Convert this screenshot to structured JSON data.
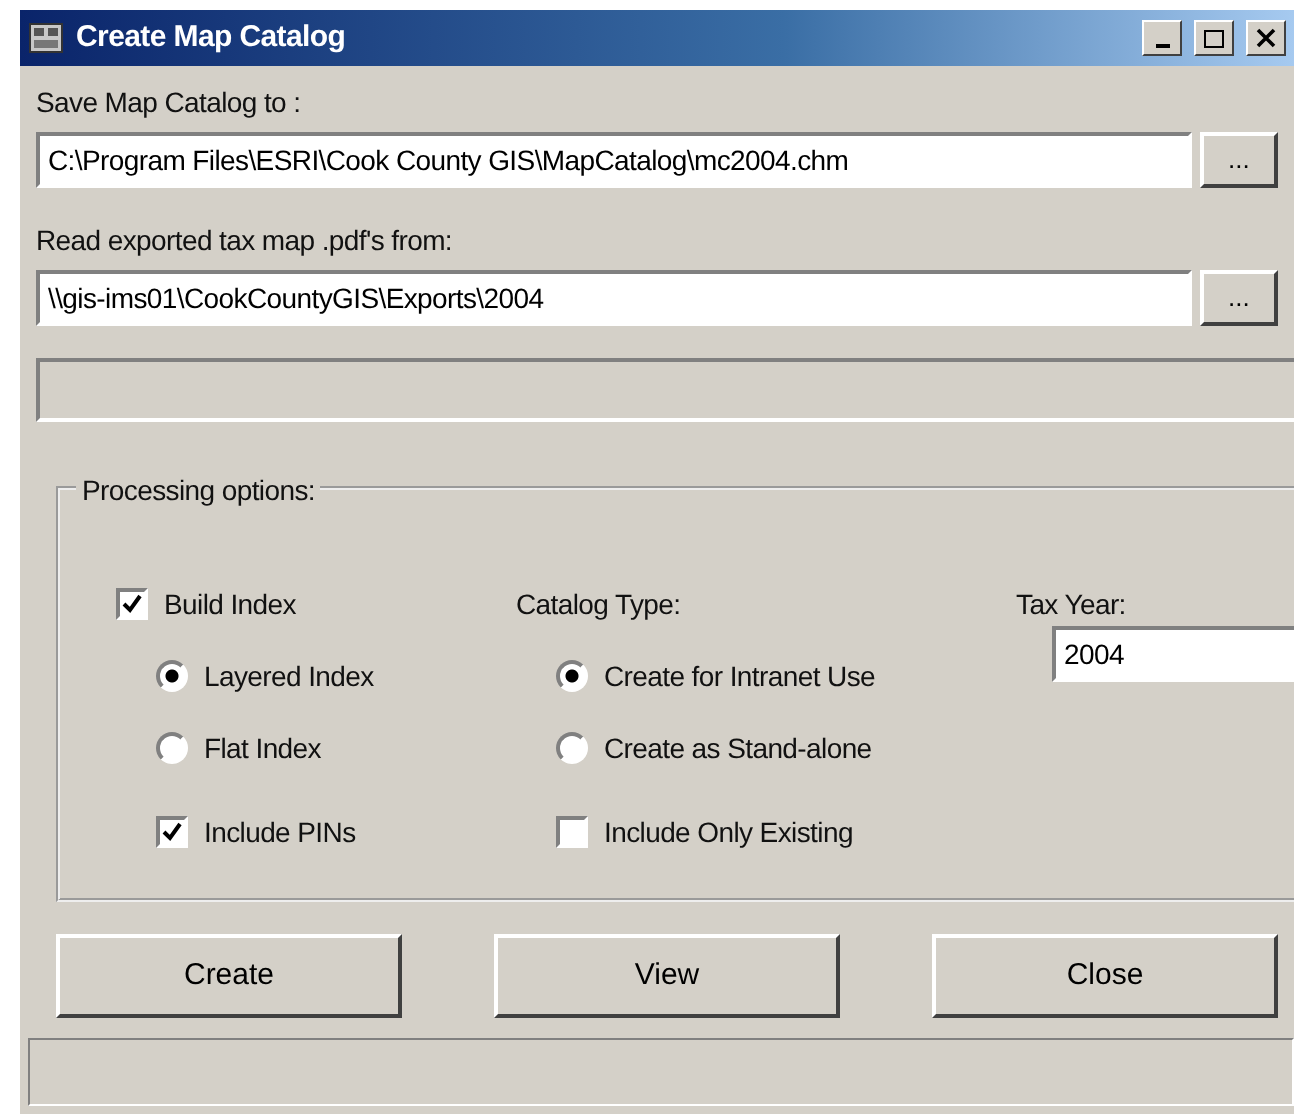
{
  "window": {
    "title": "Create Map Catalog"
  },
  "save_to": {
    "label": "Save Map Catalog to :",
    "value": "C:\\Program Files\\ESRI\\Cook County GIS\\MapCatalog\\mc2004.chm",
    "browse": "..."
  },
  "read_from": {
    "label": "Read exported tax map .pdf's from:",
    "value": "\\\\gis-ims01\\CookCountyGIS\\Exports\\2004",
    "browse": "..."
  },
  "processing_options": {
    "title": "Processing options:",
    "build_index": {
      "label": "Build Index",
      "checked": true
    },
    "index_types": [
      {
        "label": "Layered Index",
        "selected": true
      },
      {
        "label": "Flat Index",
        "selected": false
      }
    ],
    "include_pins": {
      "label": "Include PINs",
      "checked": true
    },
    "catalog_type": {
      "label": "Catalog Type:",
      "options": [
        {
          "label": "Create for Intranet Use",
          "selected": true
        },
        {
          "label": "Create as Stand-alone",
          "selected": false
        }
      ]
    },
    "include_only_existing": {
      "label": "Include Only Existing",
      "checked": false
    },
    "tax_year": {
      "label": "Tax Year:",
      "value": "2004"
    }
  },
  "buttons": [
    "Create",
    "View",
    "Close"
  ]
}
